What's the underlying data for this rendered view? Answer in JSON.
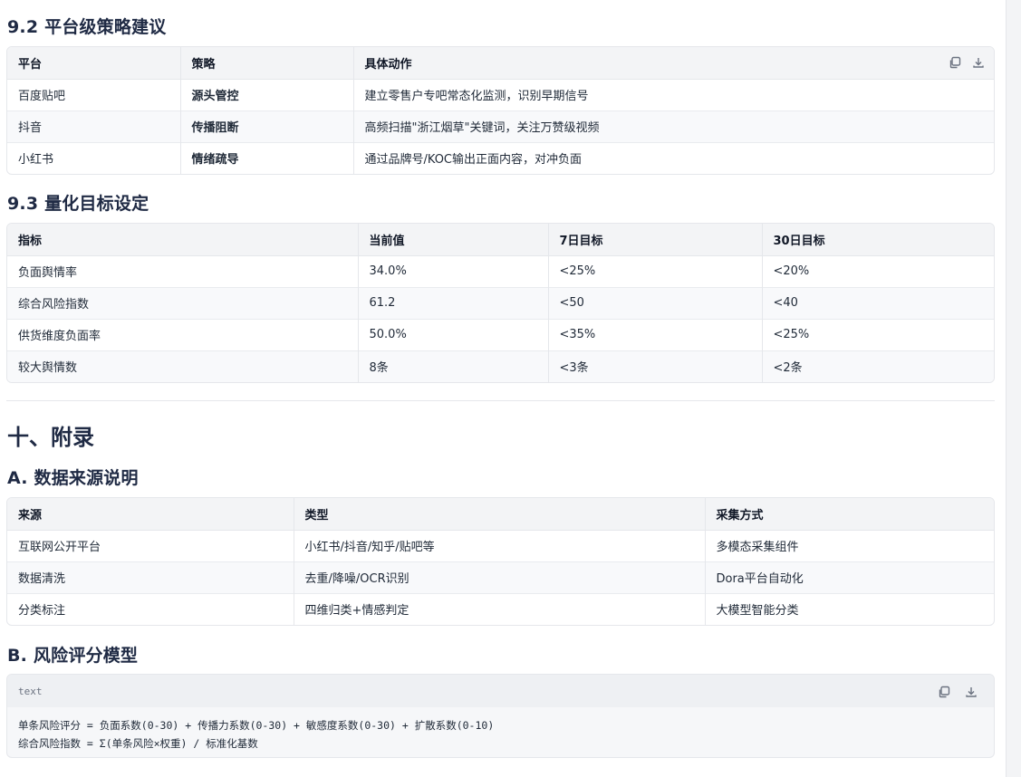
{
  "sections": {
    "s92_title": "9.2 平台级策略建议",
    "s93_title": "9.3 量化目标设定",
    "s10_title": "十、附录",
    "sA_title": "A. 数据来源说明",
    "sB_title": "B. 风险评分模型"
  },
  "platform_table": {
    "headers": [
      "平台",
      "策略",
      "具体动作"
    ],
    "rows": [
      [
        "百度贴吧",
        "源头管控",
        "建立零售户专吧常态化监测，识别早期信号"
      ],
      [
        "抖音",
        "传播阻断",
        "高频扫描\"浙江烟草\"关键词，关注万赞级视频"
      ],
      [
        "小红书",
        "情绪疏导",
        "通过品牌号/KOC输出正面内容，对冲负面"
      ]
    ]
  },
  "target_table": {
    "headers": [
      "指标",
      "当前值",
      "7日目标",
      "30日目标"
    ],
    "rows": [
      [
        "负面舆情率",
        "34.0%",
        "<25%",
        "<20%"
      ],
      [
        "综合风险指数",
        "61.2",
        "<50",
        "<40"
      ],
      [
        "供货维度负面率",
        "50.0%",
        "<35%",
        "<25%"
      ],
      [
        "较大舆情数",
        "8条",
        "<3条",
        "<2条"
      ]
    ]
  },
  "source_table": {
    "headers": [
      "来源",
      "类型",
      "采集方式"
    ],
    "rows": [
      [
        "互联网公开平台",
        "小红书/抖音/知乎/贴吧等",
        "多模态采集组件"
      ],
      [
        "数据清洗",
        "去重/降噪/OCR识别",
        "Dora平台自动化"
      ],
      [
        "分类标注",
        "四维归类+情感判定",
        "大模型智能分类"
      ]
    ]
  },
  "code_block": {
    "lang": "text",
    "line1": "单条风险评分 = 负面系数(0-30) + 传播力系数(0-30) + 敏感度系数(0-30) + 扩散系数(0-10)",
    "line2": "综合风险指数 = Σ(单条风险×权重) / 标准化基数"
  },
  "icons": [
    "copy-icon",
    "download-icon"
  ]
}
